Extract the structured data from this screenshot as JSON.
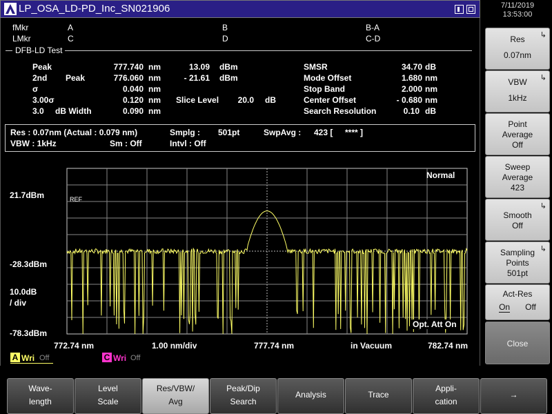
{
  "window": {
    "title": "LP_OSA_LD-PD_Inc_SN021906"
  },
  "clock": {
    "date": "7/11/2019",
    "time": "13:53:00"
  },
  "markers": {
    "fmkr": "fMkr",
    "lmkr": "LMkr",
    "a": "A",
    "b": "B",
    "ba": "B-A",
    "c": "C",
    "d": "D",
    "cd": "C-D"
  },
  "test": {
    "title": "DFB-LD Test",
    "peak_label": "Peak",
    "peak_wl": "777.740",
    "peak_wl_unit": "nm",
    "peak_lvl": "13.09",
    "peak_lvl_unit": "dBm",
    "second_label": "2nd",
    "second_peak": "Peak",
    "second_wl": "776.060",
    "second_wl_unit": "nm",
    "second_lvl": "-  21.61",
    "second_lvl_unit": "dBm",
    "sigma_label": "σ",
    "sigma_val": "0.040",
    "sigma_unit": "nm",
    "three_sigma_label": "3.00σ",
    "three_sigma_val": "0.120",
    "three_sigma_unit": "nm",
    "slice_label": "Slice Level",
    "slice_val": "20.0",
    "slice_unit": "dB",
    "width_label1": "3.0",
    "width_label2": "dB Width",
    "width_val": "0.090",
    "width_unit": "nm",
    "smsr_label": "SMSR",
    "smsr_val": "34.70",
    "smsr_unit": "dB",
    "mode_offset_label": "Mode Offset",
    "mode_offset_val": "1.680",
    "mode_offset_unit": "nm",
    "stop_band_label": "Stop Band",
    "stop_band_val": "2.000",
    "stop_band_unit": "nm",
    "center_offset_label": "Center Offset",
    "center_offset_val": "-  0.680",
    "center_offset_unit": "nm",
    "search_res_label": "Search Resolution",
    "search_res_val": "0.10",
    "search_res_unit": "dB"
  },
  "settings": {
    "res": "Res :  0.07nm (Actual :  0.079 nm)",
    "smplg": "Smplg :",
    "smplg_val": "501pt",
    "swpavg": "SwpAvg :",
    "swpavg_val": "423 [",
    "swpavg_stars": "****  ]",
    "vbw": "VBW :     1kHz",
    "sm": "Sm :     Off",
    "intvl": "Intvl :     Off"
  },
  "plot": {
    "mode": "Normal",
    "ref_label": "REF",
    "y_top": "21.7dBm",
    "y_mid": "-28.3dBm",
    "scale1": "10.0dB",
    "scale2": "/ div",
    "y_bottom": "-78.3dBm",
    "x_start": "772.74 nm",
    "x_div": "1.00 nm/div",
    "x_center": "777.74 nm",
    "medium": "in Vacuum",
    "x_end": "782.74 nm",
    "opt_att": "Opt. Att On",
    "trace_a": "A",
    "trace_a_wri": "Wri",
    "trace_a_off": "Off",
    "trace_c": "C",
    "trace_c_wri": "Wri",
    "trace_c_off": "Off",
    "trace_color": "#ffff66"
  },
  "softkeys": [
    {
      "lines": [
        "Res",
        "0.07nm"
      ]
    },
    {
      "lines": [
        "VBW",
        "1kHz"
      ]
    },
    {
      "lines": [
        "Point",
        "Average",
        "Off"
      ]
    },
    {
      "lines": [
        "Sweep",
        "Average",
        "423"
      ]
    },
    {
      "lines": [
        "Smooth",
        "Off"
      ]
    },
    {
      "lines": [
        "Sampling",
        "Points",
        "501pt"
      ]
    },
    {
      "lines": [
        "Act-Res",
        "On",
        "Off"
      ]
    },
    {
      "lines": [
        "Close"
      ]
    }
  ],
  "bottomkeys": [
    {
      "lines": [
        "Wave-",
        "length"
      ]
    },
    {
      "lines": [
        "Level",
        "Scale"
      ]
    },
    {
      "lines": [
        "Res/VBW/",
        "Avg"
      ]
    },
    {
      "lines": [
        "Peak/Dip",
        "Search"
      ]
    },
    {
      "lines": [
        "Analysis"
      ]
    },
    {
      "lines": [
        "Trace"
      ]
    },
    {
      "lines": [
        "Appli-",
        "cation"
      ]
    },
    {
      "lines": [
        "→"
      ]
    }
  ]
}
